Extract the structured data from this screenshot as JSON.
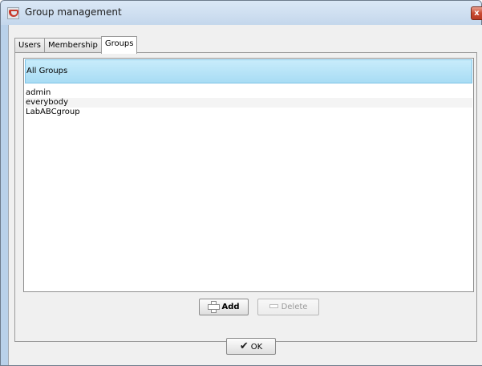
{
  "window": {
    "title": "Group management",
    "close_glyph": "x"
  },
  "tabs": [
    {
      "label": "Users",
      "active": false
    },
    {
      "label": "Membership",
      "active": false
    },
    {
      "label": "Groups",
      "active": true
    }
  ],
  "list": {
    "header": "All Groups",
    "items": [
      "admin",
      "everybody",
      "LabABCgroup"
    ]
  },
  "buttons": {
    "add_label": "Add",
    "delete_label": "Delete",
    "ok_label": "OK"
  },
  "icons": {
    "title": "app-icon",
    "add": "plus-icon",
    "delete": "minus-icon",
    "ok": "checkmark-icon"
  },
  "colors": {
    "header_bg": "#b9e4f7",
    "window_frame": "#b9d1ea",
    "close_button": "#c94a32"
  }
}
